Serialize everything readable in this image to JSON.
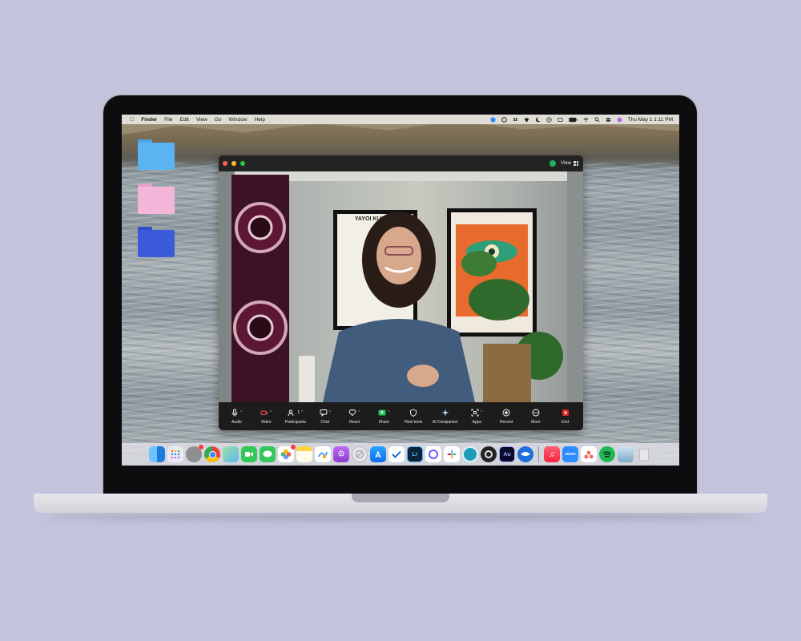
{
  "menubar": {
    "items": [
      "Finder",
      "File",
      "Edit",
      "View",
      "Go",
      "Window",
      "Help"
    ],
    "clock": "Thu May 1  1:11 PM"
  },
  "desktop": {
    "folders": [
      {
        "name": "folder-blue",
        "color": "#5ab4f2"
      },
      {
        "name": "folder-pink",
        "color": "#f3b6d8"
      },
      {
        "name": "folder-navy",
        "color": "#3b5bdb"
      }
    ]
  },
  "zoom": {
    "view_label": "View",
    "poster_text": "YAYOI KUSAMA",
    "participants_count": "1",
    "toolbar": [
      {
        "key": "audio",
        "label": "Audio"
      },
      {
        "key": "video",
        "label": "Video"
      },
      {
        "key": "participants",
        "label": "Participants"
      },
      {
        "key": "chat",
        "label": "Chat"
      },
      {
        "key": "react",
        "label": "React"
      },
      {
        "key": "share",
        "label": "Share"
      },
      {
        "key": "host-tools",
        "label": "Host tools"
      },
      {
        "key": "ai-companion",
        "label": "AI Companion"
      },
      {
        "key": "apps",
        "label": "Apps"
      },
      {
        "key": "record",
        "label": "Record"
      },
      {
        "key": "more",
        "label": "More"
      },
      {
        "key": "end",
        "label": "End"
      }
    ]
  },
  "dock": {
    "apps": [
      {
        "name": "finder",
        "color": "#3d8ef0"
      },
      {
        "name": "launchpad",
        "color": "#e9e9ef"
      },
      {
        "name": "system-settings",
        "color": "#8e8e93"
      },
      {
        "name": "chrome",
        "color": "#ffffff"
      },
      {
        "name": "maps",
        "color": "#62c36b"
      },
      {
        "name": "facetime",
        "color": "#34c759"
      },
      {
        "name": "messages",
        "color": "#34c759"
      },
      {
        "name": "photos",
        "color": "#ffffff"
      },
      {
        "name": "notes",
        "color": "#fff4b0"
      },
      {
        "name": "freeform",
        "color": "#ffffff"
      },
      {
        "name": "podcasts",
        "color": "#9b4fd6"
      },
      {
        "name": "no-entry",
        "color": "#e5e5ea"
      },
      {
        "name": "app-store",
        "color": "#1e8ef5"
      },
      {
        "name": "tasks",
        "color": "#ffffff"
      },
      {
        "name": "lightroom",
        "color": "#0b2438",
        "text": "Lr"
      },
      {
        "name": "circle-app",
        "color": "#ffffff"
      },
      {
        "name": "slack",
        "color": "#ffffff"
      },
      {
        "name": "screen-recorder",
        "color": "#1f9bb7"
      },
      {
        "name": "obs",
        "color": "#222222"
      },
      {
        "name": "audition",
        "color": "#0a0a2a",
        "text": "Au"
      },
      {
        "name": "mail-bird",
        "color": "#1e6fd9"
      },
      {
        "name": "music",
        "color": "#fa3c50"
      },
      {
        "name": "zoom",
        "color": "#2d8cff",
        "text": "zoom"
      },
      {
        "name": "asana",
        "color": "#ffffff"
      },
      {
        "name": "spotify",
        "color": "#1db954"
      },
      {
        "name": "preview",
        "color": "#7fa9c9"
      },
      {
        "name": "trash",
        "color": "#e5e5ea"
      }
    ]
  }
}
